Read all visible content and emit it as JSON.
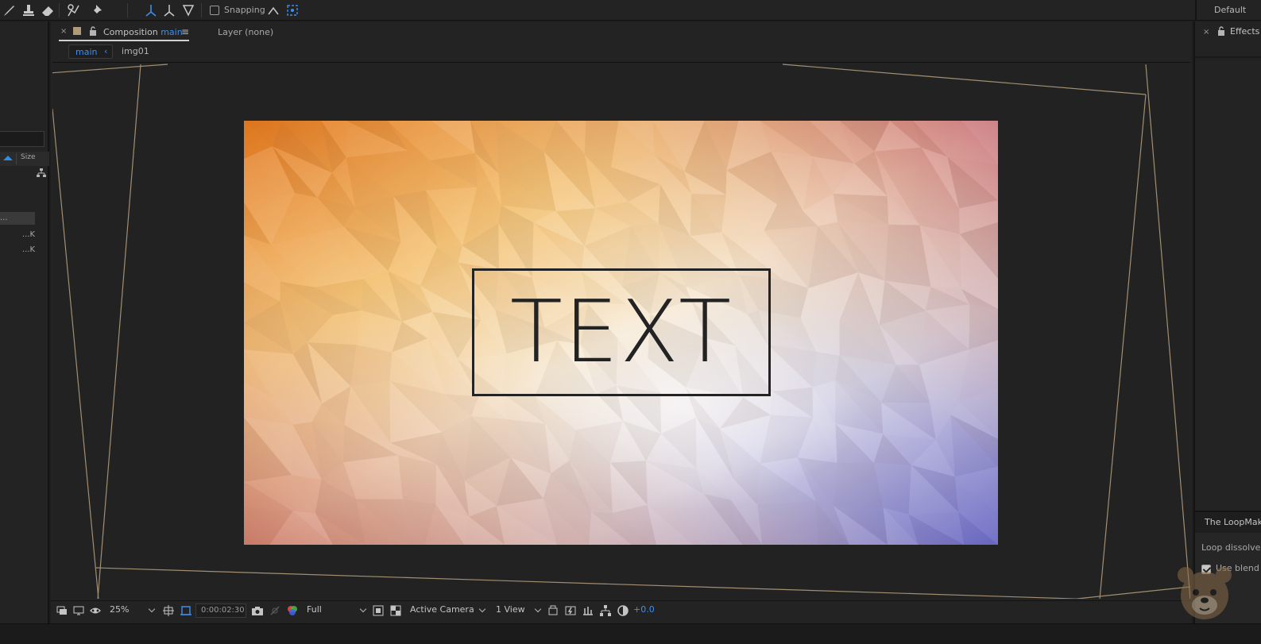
{
  "toolbar": {
    "snapping_label": "Snapping",
    "workspace_label": "Default",
    "tools": [
      "brush-tool",
      "clone-stamp-tool",
      "eraser-tool",
      "roto-brush-tool",
      "puppet-pin-tool"
    ],
    "axis_modes": [
      "local-axis-mode",
      "world-axis-mode",
      "view-axis-mode"
    ]
  },
  "left_panel": {
    "column_header": "Size",
    "rows": [
      {
        "size": ""
      },
      {
        "size": ""
      },
      {
        "size": "..."
      },
      {
        "size": "...K"
      },
      {
        "size": "...K"
      }
    ]
  },
  "composition_panel": {
    "tab_prefix": "Composition",
    "tab_name": "main",
    "layer_tab": "Layer (none)",
    "breadcrumbs": [
      "main",
      "img01"
    ],
    "canvas_text": "TEXT"
  },
  "viewer_bar": {
    "zoom": "25%",
    "timecode": "0:00:02:30",
    "resolution": "Full",
    "camera": "Active Camera",
    "views": "1 View",
    "exposure": "+0.0"
  },
  "right_panel": {
    "tab_title": "Effects",
    "plugin_title": "The LoopMaker",
    "loop_label": "Loop dissolve",
    "use_label": "Use blend"
  },
  "colors": {
    "accent": "#3d8ef0",
    "panel_bg": "#232323",
    "frame_line": "#b09a7a"
  }
}
